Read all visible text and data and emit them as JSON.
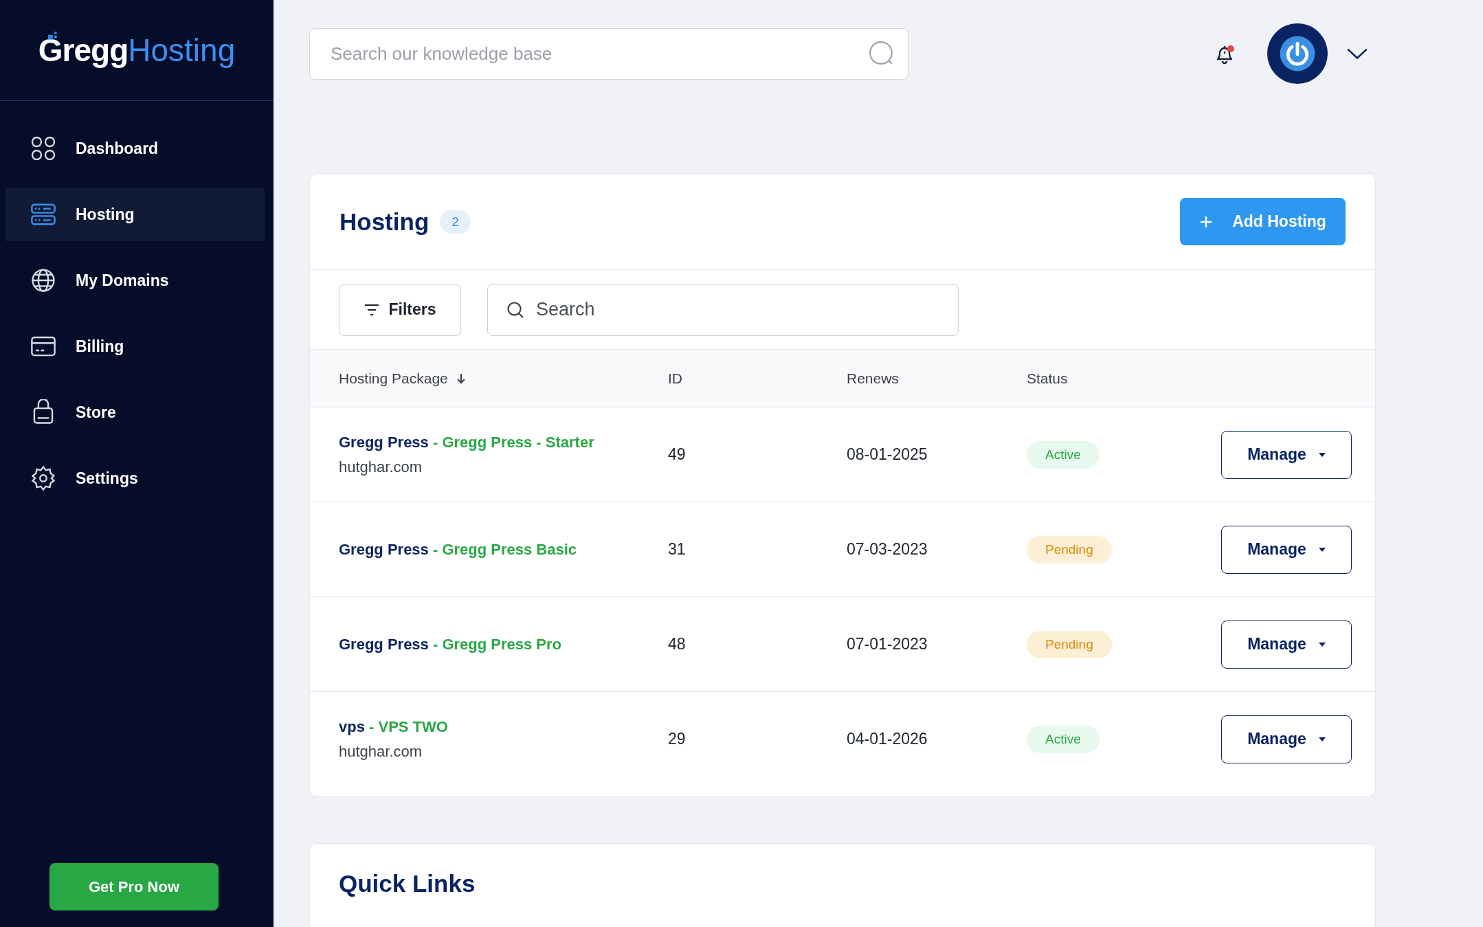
{
  "logo": {
    "part_1": "Gregg",
    "part_2": "Hosting"
  },
  "sidebar": {
    "items": [
      {
        "label": "Dashboard",
        "selected": false
      },
      {
        "label": "Hosting",
        "selected": true
      },
      {
        "label": "My Domains",
        "selected": false
      },
      {
        "label": "Billing",
        "selected": false
      },
      {
        "label": "Store",
        "selected": false
      },
      {
        "label": "Settings",
        "selected": false
      }
    ],
    "cta": "Get Pro Now"
  },
  "header": {
    "search": {
      "placeholder": "Search our knowledge base"
    },
    "notifications": {
      "unread": true
    }
  },
  "hosting": {
    "title": "Hosting",
    "count": "2",
    "add_button": "Add Hosting",
    "filters_button": "Filters",
    "search": {
      "placeholder": "Search"
    },
    "columns": [
      "Hosting Package",
      "ID",
      "Renews",
      "Status"
    ],
    "rows": [
      {
        "package": "Gregg Press",
        "plan": "- Gregg Press - Starter",
        "domain": "hutghar.com",
        "id": "49",
        "renews": "08-01-2025",
        "status": {
          "label": "Active",
          "kind": "active"
        },
        "action": "Manage"
      },
      {
        "package": "Gregg Press",
        "plan": "- Gregg Press Basic",
        "id": "31",
        "renews": "07-03-2023",
        "status": {
          "label": "Pending",
          "kind": "pending"
        },
        "action": "Manage"
      },
      {
        "package": "Gregg Press",
        "plan": "- Gregg Press Pro",
        "id": "48",
        "renews": "07-01-2023",
        "status": {
          "label": "Pending",
          "kind": "pending"
        },
        "action": "Manage"
      },
      {
        "package": "vps",
        "plan": "- VPS TWO",
        "domain": "hutghar.com",
        "id": "29",
        "renews": "04-01-2026",
        "status": {
          "label": "Active",
          "kind": "active"
        },
        "action": "Manage"
      }
    ]
  },
  "quick_links": {
    "title": "Quick Links"
  }
}
